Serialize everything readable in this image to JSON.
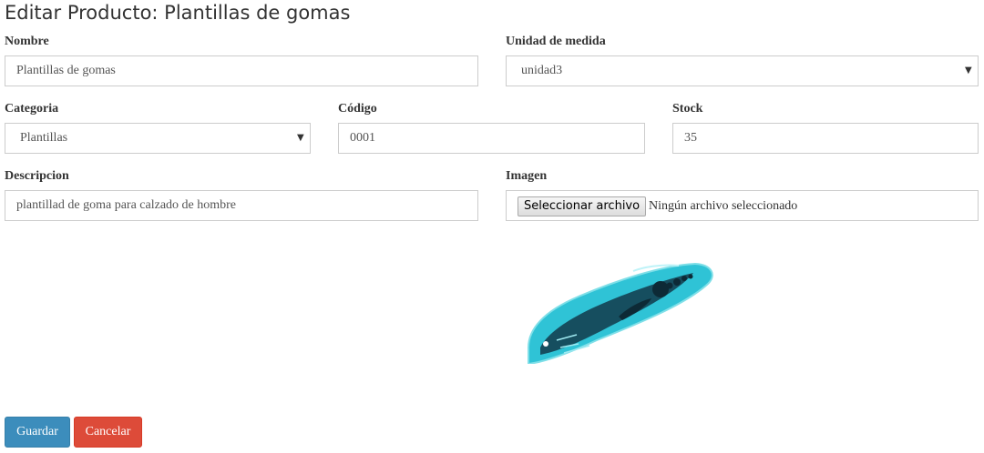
{
  "page": {
    "title": "Editar Producto: Plantillas de gomas"
  },
  "form": {
    "nombre": {
      "label": "Nombre",
      "value": "Plantillas de gomas"
    },
    "unidad": {
      "label": "Unidad de medida",
      "value": "unidad3"
    },
    "categoria": {
      "label": "Categoria",
      "value": "Plantillas"
    },
    "codigo": {
      "label": "Código",
      "value": "0001"
    },
    "stock": {
      "label": "Stock",
      "value": "35"
    },
    "descripcion": {
      "label": "Descripcion",
      "value": "plantillad de goma para calzado de hombre"
    },
    "imagen": {
      "label": "Imagen",
      "button_label": "Seleccionar archivo",
      "status": "Ningún archivo seleccionado"
    }
  },
  "product_image": {
    "icon": "insole-image"
  },
  "actions": {
    "save_label": "Guardar",
    "cancel_label": "Cancelar"
  },
  "colors": {
    "primary": "#3c8dbc",
    "danger": "#dd4b39",
    "border": "#cccccc"
  }
}
